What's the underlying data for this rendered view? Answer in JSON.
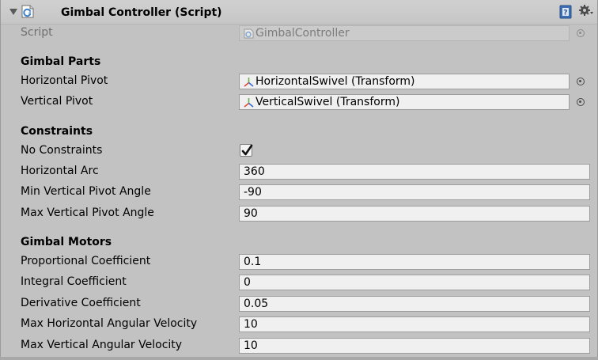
{
  "component": {
    "title": "Gimbal Controller (Script)",
    "script_label": "Script",
    "script_value": "GimbalController"
  },
  "sections": {
    "gimbal_parts": "Gimbal Parts",
    "constraints": "Constraints",
    "gimbal_motors": "Gimbal Motors"
  },
  "fields": {
    "horizontal_pivot": {
      "label": "Horizontal Pivot",
      "value": "HorizontalSwivel (Transform)"
    },
    "vertical_pivot": {
      "label": "Vertical Pivot",
      "value": "VerticalSwivel (Transform)"
    },
    "no_constraints": {
      "label": "No Constraints",
      "checked": true
    },
    "horizontal_arc": {
      "label": "Horizontal Arc",
      "value": "360"
    },
    "min_vertical": {
      "label": "Min Vertical Pivot Angle",
      "value": "-90"
    },
    "max_vertical": {
      "label": "Max Vertical Pivot Angle",
      "value": "90"
    },
    "proportional": {
      "label": "Proportional Coefficient",
      "value": "0.1"
    },
    "integral": {
      "label": "Integral Coefficient",
      "value": "0"
    },
    "derivative": {
      "label": "Derivative Coefficient",
      "value": "0.05"
    },
    "max_h_vel": {
      "label": "Max Horizontal Angular Velocity",
      "value": "10"
    },
    "max_v_vel": {
      "label": "Max Vertical Angular Velocity",
      "value": "10"
    }
  },
  "icons": {
    "foldout": "foldout-arrow-icon",
    "script": "csharp-script-icon",
    "help": "help-book-icon",
    "settings": "gear-icon",
    "transform": "transform-axes-icon",
    "picker": "object-picker-icon"
  },
  "colors": {
    "panel_bg": "#c2c2c2",
    "field_bg": "#f0f0f0",
    "script_icon": "#3a7fc8",
    "axis_x": "#e04a3a",
    "axis_y": "#6ab04a",
    "axis_z": "#3a6ad0"
  }
}
